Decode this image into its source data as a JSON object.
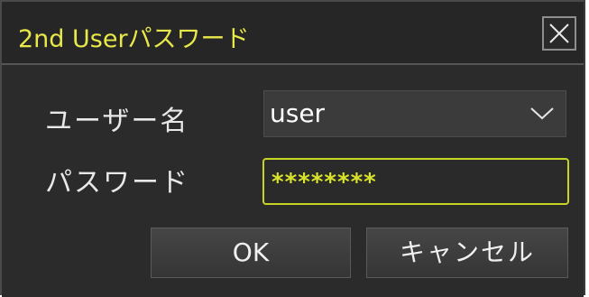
{
  "dialog": {
    "title": "2nd Userパスワード",
    "close_icon": "close-icon"
  },
  "form": {
    "user_label": "ユーザー名",
    "user_value": "user",
    "dropdown_icon": "chevron-down-icon",
    "password_label": "パスワード",
    "password_value": "********"
  },
  "buttons": {
    "ok_label": "OK",
    "cancel_label": "キャンセル"
  },
  "colors": {
    "title_text": "#e8e84a",
    "focus_border": "#c8d424",
    "background": "#2b2b2b"
  }
}
